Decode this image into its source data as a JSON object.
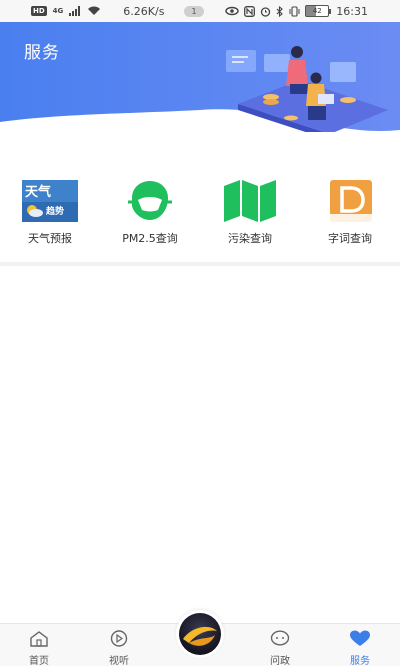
{
  "status_bar": {
    "hd_badge": "HD",
    "signal_badge": "4G",
    "net_speed": "6.26K/s",
    "notification_count": "1",
    "battery_level": "42",
    "time": "16:31"
  },
  "header": {
    "title": "服务"
  },
  "services": [
    {
      "label": "天气预报",
      "icon": "weather-forecast-icon",
      "icon_text_top": "天气",
      "icon_text_bottom": "趋势"
    },
    {
      "label": "PM2.5查询",
      "icon": "mask-icon"
    },
    {
      "label": "污染查询",
      "icon": "map-icon"
    },
    {
      "label": "字词查询",
      "icon": "dictionary-icon"
    }
  ],
  "bottom_nav": {
    "items": [
      {
        "label": "首页",
        "icon": "home-icon"
      },
      {
        "label": "视听",
        "icon": "play-icon"
      },
      {
        "label": "问政",
        "icon": "chat-icon"
      },
      {
        "label": "服务",
        "icon": "heart-icon"
      }
    ],
    "active": "服务"
  },
  "colors": {
    "banner_start": "#4a7ff0",
    "banner_end": "#6b8cf3",
    "accent_blue": "#3d7fe8",
    "green": "#1fbf5e",
    "orange": "#f0a040"
  }
}
